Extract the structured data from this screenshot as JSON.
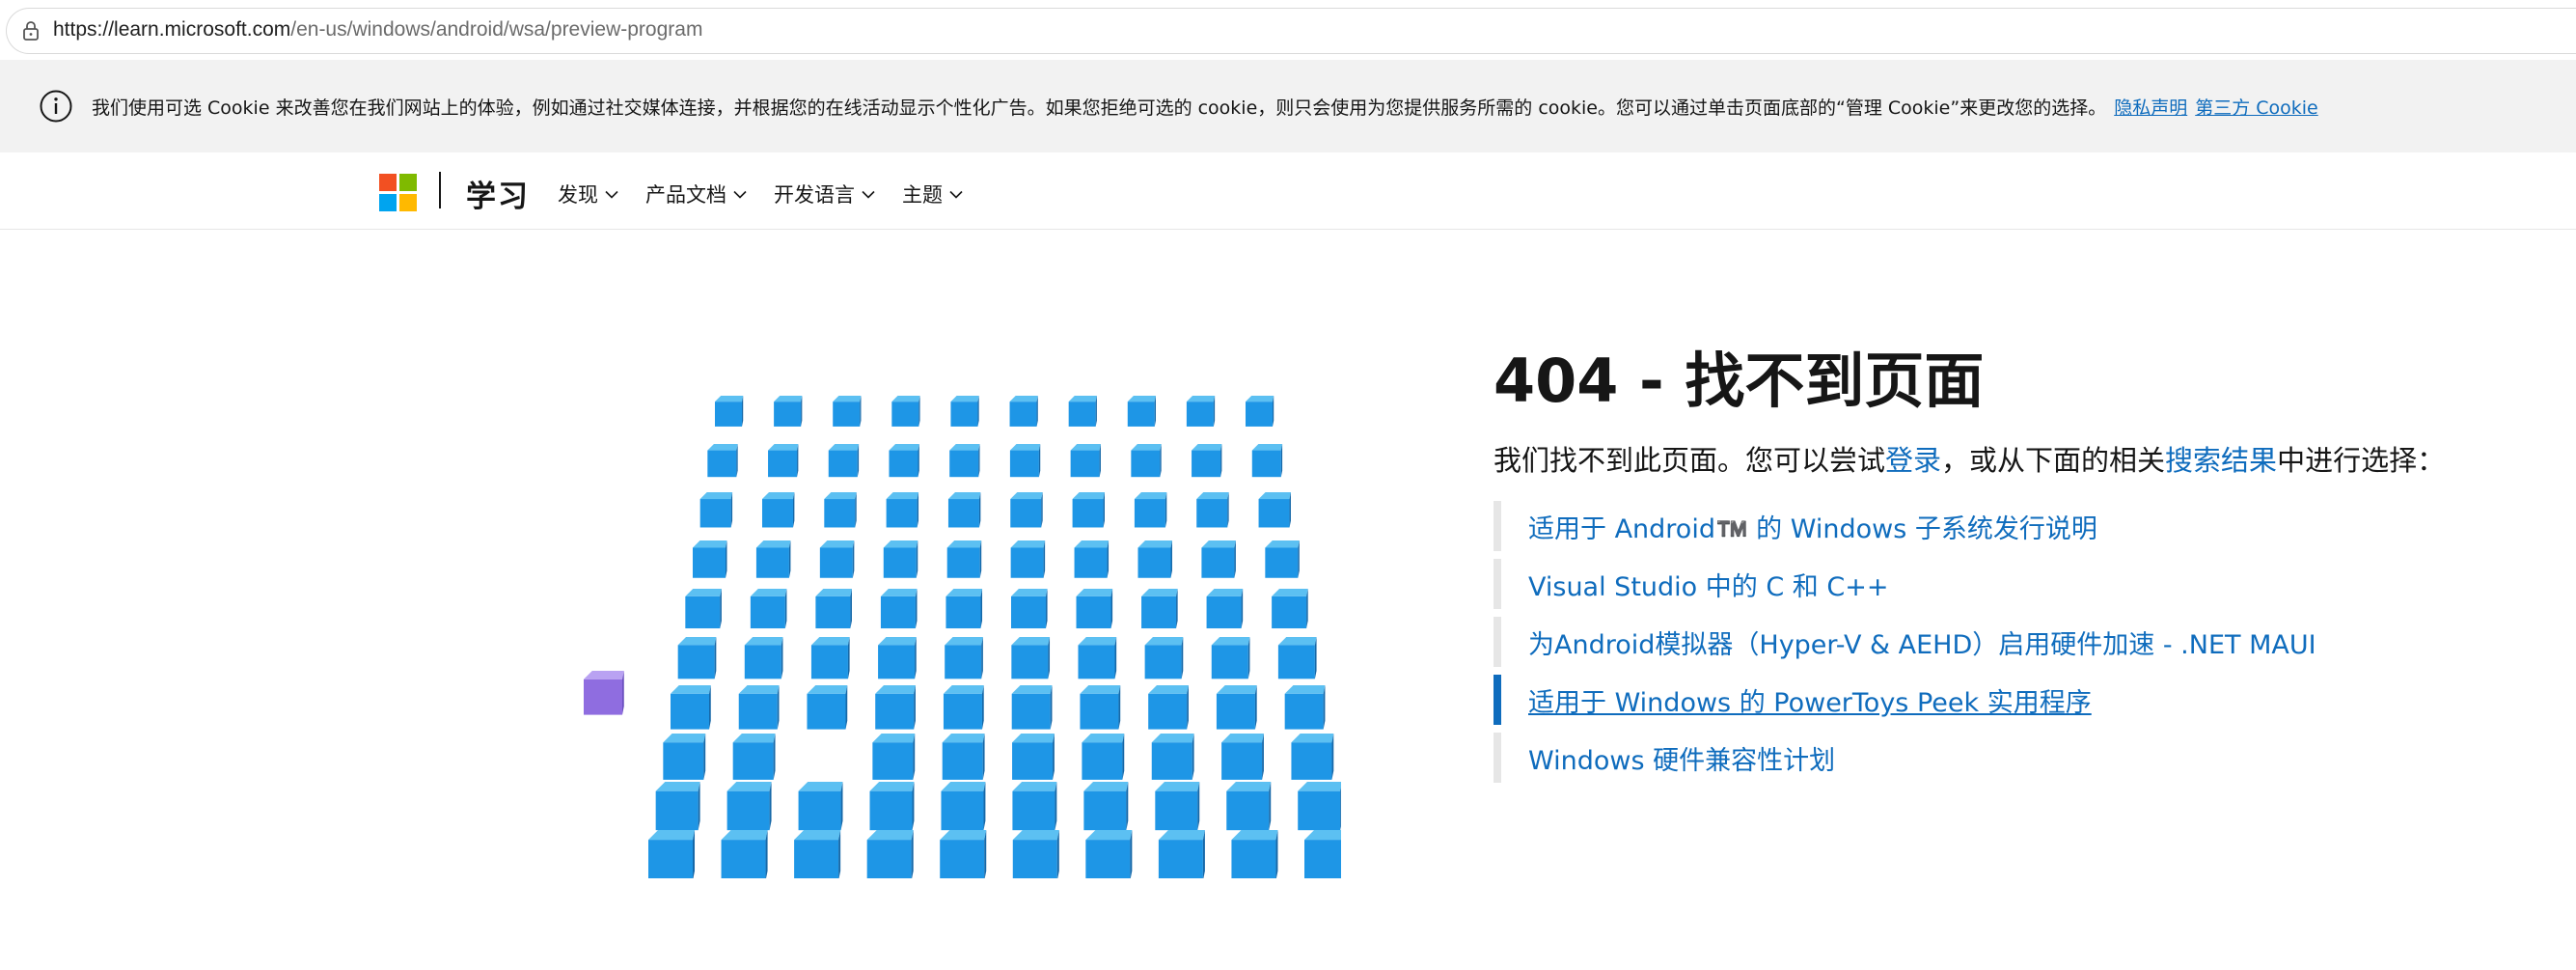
{
  "browser": {
    "url_host": "https://learn.microsoft.com",
    "url_path": "/en-us/windows/android/wsa/preview-program"
  },
  "cookie_banner": {
    "message": "我们使用可选 Cookie 来改善您在我们网站上的体验，例如通过社交媒体连接，并根据您的在线活动显示个性化广告。如果您拒绝可选的 cookie，则只会使用为您提供服务所需的 cookie。您可以通过单击页面底部的“管理 Cookie”来更改您的选择。",
    "privacy_link": "隐私声明",
    "third_party_link": "第三方 Cookie"
  },
  "header": {
    "brand": "学习",
    "nav": [
      {
        "label": "发现"
      },
      {
        "label": "产品文档"
      },
      {
        "label": "开发语言"
      },
      {
        "label": "主题"
      }
    ]
  },
  "error": {
    "title": "404 - 找不到页面",
    "lead_before": "我们找不到此页面。您可以尝试",
    "signin_link": "登录",
    "lead_middle": "，或从下面的相关",
    "search_link": "搜索结果",
    "lead_after": "中进行选择："
  },
  "results": [
    {
      "label": "适用于 Android™️ 的 Windows 子系统发行说明"
    },
    {
      "label": "Visual Studio 中的 C 和 C++"
    },
    {
      "label": "为Android模拟器（Hyper-V & AEHD）启用硬件加速 - .NET MAUI"
    },
    {
      "label": "适用于 Windows 的 PowerToys Peek 实用程序",
      "active": true
    },
    {
      "label": "Windows 硬件兼容性计划"
    }
  ],
  "colors": {
    "link": "#0f6cbd",
    "cube_top": "#5cc0f2",
    "cube_front": "#1e96e6",
    "cube_side": "#1668a8",
    "stray_cube": "#8f6de0",
    "ms_red": "#f25022",
    "ms_green": "#7fba00",
    "ms_blue": "#00a4ef",
    "ms_yellow": "#ffb900"
  }
}
